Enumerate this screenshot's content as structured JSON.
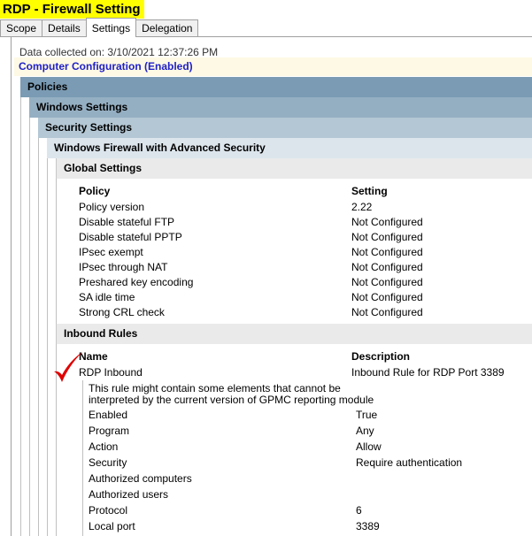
{
  "title": "RDP - Firewall Setting",
  "tabs": [
    {
      "label": "Scope"
    },
    {
      "label": "Details"
    },
    {
      "label": "Settings",
      "active": true
    },
    {
      "label": "Delegation"
    }
  ],
  "collected": "Data collected on: 3/10/2021 12:37:26 PM",
  "computer_configuration": "Computer Configuration (Enabled)",
  "sections": {
    "policies": "Policies",
    "windows_settings": "Windows Settings",
    "security_settings": "Security Settings",
    "wfas": "Windows Firewall with Advanced Security",
    "global_settings": "Global Settings",
    "inbound_rules": "Inbound Rules"
  },
  "global_table": {
    "headers": [
      "Policy",
      "Setting"
    ],
    "rows": [
      [
        "Policy version",
        "2.22"
      ],
      [
        "Disable stateful FTP",
        "Not Configured"
      ],
      [
        "Disable stateful PPTP",
        "Not Configured"
      ],
      [
        "IPsec exempt",
        "Not Configured"
      ],
      [
        "IPsec through NAT",
        "Not Configured"
      ],
      [
        "Preshared key encoding",
        "Not Configured"
      ],
      [
        "SA idle time",
        "Not Configured"
      ],
      [
        "Strong CRL check",
        "Not Configured"
      ]
    ]
  },
  "inbound_table": {
    "headers": [
      "Name",
      "Description"
    ],
    "rule": [
      "RDP Inbound",
      "Inbound Rule for RDP Port 3389"
    ],
    "note_line1": "This rule might contain some elements that cannot be",
    "note_line2": "interpreted by the current version of GPMC reporting module",
    "details": [
      [
        "Enabled",
        "True"
      ],
      [
        "Program",
        "Any"
      ],
      [
        "Action",
        "Allow"
      ],
      [
        "Security",
        "Require authentication"
      ],
      [
        "Authorized computers",
        ""
      ],
      [
        "Authorized users",
        ""
      ],
      [
        "Protocol",
        "6"
      ],
      [
        "Local port",
        "3389"
      ]
    ]
  },
  "colors": {
    "title_highlight": "#ffff00",
    "link_blue": "#2020c8",
    "checkmark_red": "#e00000"
  }
}
